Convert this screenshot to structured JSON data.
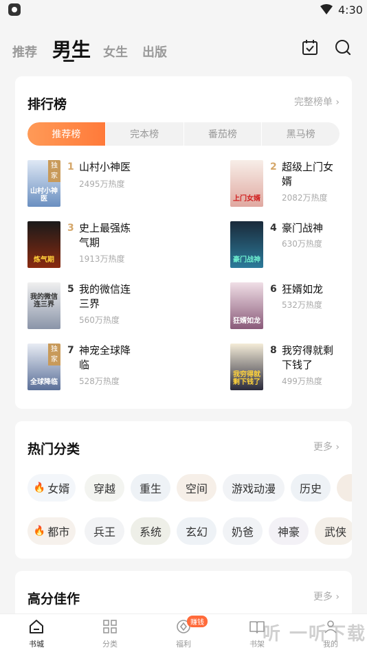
{
  "status_bar": {
    "time": "4:30"
  },
  "top_nav": {
    "tabs": [
      {
        "label": "推荐"
      },
      {
        "label": "男生"
      },
      {
        "label": "女生"
      },
      {
        "label": "出版"
      }
    ],
    "active_tab": "男生",
    "icons": [
      "calendar-check-icon",
      "search-icon"
    ]
  },
  "ranking": {
    "title": "排行榜",
    "more": "完整榜单",
    "tabs": [
      "推荐榜",
      "完本榜",
      "番茄榜",
      "黑马榜"
    ],
    "active_tab": "推荐榜",
    "books": [
      {
        "rank": "1",
        "name": "山村小神医",
        "heat": "2495万热度",
        "badge": "独家",
        "cover_text": "山村小神医",
        "cover_color": "#6a8fc0",
        "rank_color": "#d5a76a"
      },
      {
        "rank": "2",
        "name": "超级上门女婿",
        "heat": "2082万热度",
        "badge": "",
        "cover_text": "上门女婿",
        "cover_color": "#e8c6c0",
        "rank_color": "#d5a76a"
      },
      {
        "rank": "3",
        "name": "史上最强炼气期",
        "heat": "1913万热度",
        "badge": "",
        "cover_text": "炼气期",
        "cover_color": "#4a2a1a",
        "rank_color": "#d5a76a"
      },
      {
        "rank": "4",
        "name": "豪门战神",
        "heat": "630万热度",
        "badge": "",
        "cover_text": "豪门战神",
        "cover_color": "#2c5a7a",
        "rank_color": "#333333"
      },
      {
        "rank": "5",
        "name": "我的微信连三界",
        "heat": "560万热度",
        "badge": "",
        "cover_text": "我的微信连三界",
        "cover_color": "#b0b8c8",
        "rank_color": "#333333"
      },
      {
        "rank": "6",
        "name": "狂婿如龙",
        "heat": "532万热度",
        "badge": "",
        "cover_text": "狂婿如龙",
        "cover_color": "#c9a0b0",
        "rank_color": "#333333"
      },
      {
        "rank": "7",
        "name": "神宠全球降临",
        "heat": "528万热度",
        "badge": "独家",
        "cover_text": "全球降临",
        "cover_color": "#7a8fb0",
        "rank_color": "#333333"
      },
      {
        "rank": "8",
        "name": "我穷得就剩下钱了",
        "heat": "499万热度",
        "badge": "",
        "cover_text": "我穷得就剩下钱了",
        "cover_color": "#3a3a4a",
        "rank_color": "#333333"
      }
    ]
  },
  "categories": {
    "title": "热门分类",
    "more": "更多",
    "row1": [
      {
        "label": "女婿",
        "hot": true,
        "bg": "#f3f6fa"
      },
      {
        "label": "穿越",
        "hot": false,
        "bg": "#f3f4f0"
      },
      {
        "label": "重生",
        "hot": false,
        "bg": "#eef2f6"
      },
      {
        "label": "空间",
        "hot": false,
        "bg": "#f6efe8"
      },
      {
        "label": "游戏动漫",
        "hot": false,
        "bg": "#f1f3f6"
      },
      {
        "label": "历史",
        "hot": false,
        "bg": "#eef2f6"
      }
    ],
    "row2": [
      {
        "label": "都市",
        "hot": true,
        "bg": "#f6f1ec"
      },
      {
        "label": "兵王",
        "hot": false,
        "bg": "#f2f3f5"
      },
      {
        "label": "系统",
        "hot": false,
        "bg": "#eeefe8"
      },
      {
        "label": "玄幻",
        "hot": false,
        "bg": "#eef2f6"
      },
      {
        "label": "奶爸",
        "hot": false,
        "bg": "#f1f3f6"
      },
      {
        "label": "神豪",
        "hot": false,
        "bg": "#f3f1f6"
      },
      {
        "label": "武侠",
        "hot": false,
        "bg": "#f4efe8"
      }
    ]
  },
  "high_score": {
    "title": "高分佳作",
    "more": "更多"
  },
  "tab_bar": {
    "items": [
      {
        "label": "书城",
        "icon": "bookstore-home-icon",
        "active": true
      },
      {
        "label": "分类",
        "icon": "category-grid-icon",
        "active": false
      },
      {
        "label": "福利",
        "icon": "coin-icon",
        "active": false,
        "badge": "赚钱"
      },
      {
        "label": "书架",
        "icon": "bookshelf-icon",
        "active": false
      },
      {
        "label": "我的",
        "icon": "profile-icon",
        "active": false
      }
    ]
  },
  "watermark": "听 一听下载",
  "colors": {
    "accent": "#ff7a3a",
    "rank_top": "#d5a76a"
  }
}
